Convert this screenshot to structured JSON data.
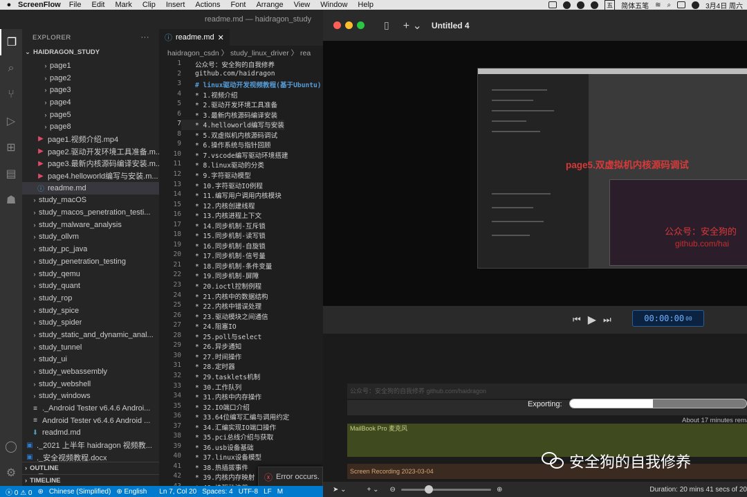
{
  "menubar": {
    "app": "ScreenFlow",
    "items": [
      "File",
      "Edit",
      "Mark",
      "Clip",
      "Insert",
      "Actions",
      "Font",
      "Arrange",
      "View",
      "Window",
      "Help"
    ],
    "ime": "五",
    "ime_label": "简体五笔",
    "clock": "3月4日 周六"
  },
  "vscode": {
    "window_title": "readme.md — haidragon_study",
    "explorer_label": "EXPLORER",
    "root_folder": "HAIDRAGON_STUDY",
    "tree": [
      {
        "kind": "folder",
        "depth": 3,
        "label": "page1"
      },
      {
        "kind": "folder",
        "depth": 3,
        "label": "page2"
      },
      {
        "kind": "folder",
        "depth": 3,
        "label": "page3"
      },
      {
        "kind": "folder",
        "depth": 3,
        "label": "page4"
      },
      {
        "kind": "folder",
        "depth": 3,
        "label": "page5"
      },
      {
        "kind": "folder",
        "depth": 3,
        "label": "page8"
      },
      {
        "kind": "mp4",
        "depth": 2,
        "label": "page1.视频介绍.mp4"
      },
      {
        "kind": "mp4",
        "depth": 2,
        "label": "page2.驱动开发环境工具准备.m..."
      },
      {
        "kind": "mp4",
        "depth": 2,
        "label": "page3.最新内核源码编译安装.m..."
      },
      {
        "kind": "mp4",
        "depth": 2,
        "label": "page4.helloworld编写与安装.m..."
      },
      {
        "kind": "md",
        "depth": 2,
        "label": "readme.md",
        "selected": true
      },
      {
        "kind": "folder",
        "depth": 1,
        "label": "study_macOS"
      },
      {
        "kind": "folder",
        "depth": 1,
        "label": "study_macos_penetration_testi..."
      },
      {
        "kind": "folder",
        "depth": 1,
        "label": "study_malware_analysis"
      },
      {
        "kind": "folder",
        "depth": 1,
        "label": "study_ollvm"
      },
      {
        "kind": "folder",
        "depth": 1,
        "label": "study_pc_java"
      },
      {
        "kind": "folder",
        "depth": 1,
        "label": "study_penetration_testing"
      },
      {
        "kind": "folder",
        "depth": 1,
        "label": "study_qemu"
      },
      {
        "kind": "folder",
        "depth": 1,
        "label": "study_quant"
      },
      {
        "kind": "folder",
        "depth": 1,
        "label": "study_rop"
      },
      {
        "kind": "folder",
        "depth": 1,
        "label": "study_spice"
      },
      {
        "kind": "folder",
        "depth": 1,
        "label": "study_spider"
      },
      {
        "kind": "folder",
        "depth": 1,
        "label": "study_static_and_dynamic_anal..."
      },
      {
        "kind": "folder",
        "depth": 1,
        "label": "study_tunnel"
      },
      {
        "kind": "folder",
        "depth": 1,
        "label": "study_ui"
      },
      {
        "kind": "folder",
        "depth": 1,
        "label": "study_webassembly"
      },
      {
        "kind": "folder",
        "depth": 1,
        "label": "study_webshell"
      },
      {
        "kind": "folder",
        "depth": 1,
        "label": "study_windows"
      },
      {
        "kind": "txt",
        "depth": 1,
        "label": "._Android Tester v6.4.6 Androi..."
      },
      {
        "kind": "txt",
        "depth": 1,
        "label": "Android Tester v6.4.6 Android ..."
      },
      {
        "kind": "arrow",
        "depth": 1,
        "label": "readmd.md"
      },
      {
        "kind": "doc",
        "depth": 0,
        "label": "._2021 上半年 haidragon 视频教..."
      },
      {
        "kind": "doc",
        "depth": 0,
        "label": "._安全视频教程.docx"
      },
      {
        "kind": "doc",
        "depth": 0,
        "label": "._介绍.docx"
      }
    ],
    "outline_label": "OUTLINE",
    "timeline_label": "TIMELINE",
    "tab_label": "readme.md",
    "breadcrumb": "haidragon_csdn 〉 study_linux_driver 〉 rea",
    "lines": [
      "公众号：安全狗的自我修养",
      "github.com/haidragon",
      "# linux驱动开发视频教程(基于Ubuntu)",
      "* 1.视频介绍",
      "* 2.驱动开发环境工具准备",
      "* 3.最新内核源码编译安装",
      "* 4.helloworld编写与安装",
      "* 5.双虚拟机内核源码调试",
      "* 6.操作系统与指针回顾",
      "* 7.vscode编写驱动环境搭建",
      "* 8.linux驱动的分类",
      "* 9.字符驱动模型",
      "* 10.字符驱动IO例程",
      "* 11.编写用户调用内核模块",
      "* 12.内核创建线程",
      "* 13.内核进程上下文",
      "* 14.同步机制-互斥锁",
      "* 15.同步机制-读写锁",
      "* 16.同步机制-自旋锁",
      "* 17.同步机制-信号量",
      "* 18.同步机制-条件变量",
      "* 19.同步机制-屏障",
      "* 20.ioctl控制例程",
      "* 21.内核中的数据结构",
      "* 22.内核中错误处理",
      "* 23.驱动模块之间通信",
      "* 24.阻塞IO",
      "* 25.poll与select",
      "* 26.异步通知",
      "* 27.时间操作",
      "* 28.定时器",
      "* 29.tasklets机制",
      "* 30.工作队列",
      "* 31.内核中内存操作",
      "* 32.IO端口介绍",
      "* 33.64位编写汇编与调用约定",
      "* 34.汇编实现IO端口操作",
      "* 35.pci总线介绍与获取",
      "* 36.usb设备基础",
      "* 37.linux设备模型",
      "* 38.热插拔事件",
      "* 39.内核内存映射",
      "* 40.块驱动注册"
    ],
    "current_line": 7,
    "toast": "Error occurs.",
    "status": {
      "errors": "0",
      "warnings": "0",
      "language": "Chinese (Simplified)",
      "locale": "English",
      "position": "Ln 7, Col 20",
      "spaces": "Spaces: 4",
      "encoding": "UTF-8",
      "eol": "LF",
      "mode": "M"
    }
  },
  "screenflow": {
    "doc_title": "Untitled 4",
    "preview_text_1": "page5.双虚拟机内核源码调试",
    "preview_text_2": "公众号：安全狗的",
    "preview_text_3": "github.com/hai",
    "timecode": "00:00:00",
    "timecode_frames": "00",
    "export_label": "Exporting:",
    "export_progress": 0.47,
    "export_remaining": "About 17 minutes rema",
    "track_label_1": "公众号：安全狗的自我修养 github.com/haidragon",
    "track_label_2": "MailBook Pro 麦克风",
    "track_label_3": "Screen Recording 2023-03-04",
    "watermark": "安全狗的自我修养",
    "duration": "Duration: 20 mins 41 secs of 20"
  },
  "colors": {
    "vscode_blue": "#007acc",
    "timecode_blue": "#6fb0ff",
    "watermark_red": "#d63a3a"
  }
}
